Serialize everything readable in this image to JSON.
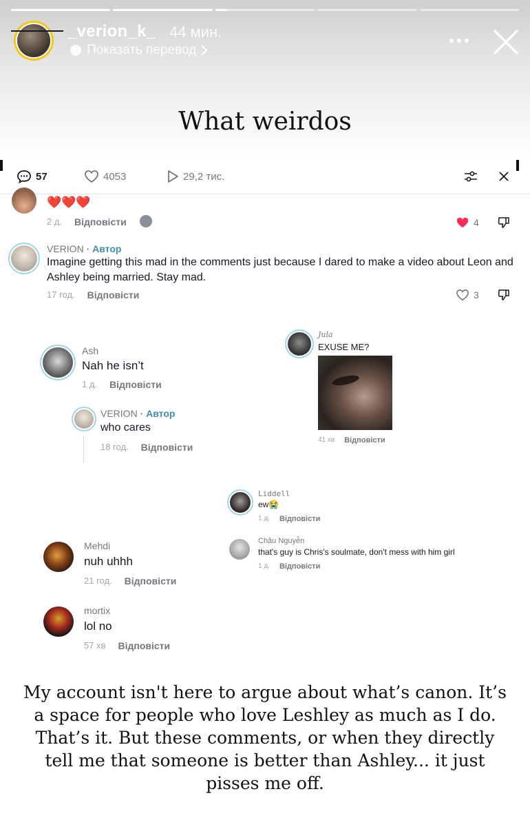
{
  "story": {
    "username": "_verion_k_",
    "time": "44 мин.",
    "translate_label": "Показать перевод",
    "progress": [
      1.0,
      1.0,
      0.12,
      0.0,
      0.0
    ],
    "caption_top": "What weirdos",
    "caption_bottom": "My account isn't here to argue about what’s canon. It’s a space for people who love Leshley as much as I do. That’s it. But these comments, or when they directly tell me that someone is better than Ashley... it just pisses me off."
  },
  "tabs": {
    "comments": "57",
    "likes": "4053",
    "views": "29,2 тис."
  },
  "comments": {
    "c0": {
      "text": "❤️❤️❤️",
      "time": "2 д.",
      "reply": "Відповісти",
      "likes": "4"
    },
    "c1": {
      "name": "VERION",
      "author": "· Автор",
      "text": "Imagine getting this mad in the comments just because I dared to make a video about Leon and Ashley being married. Stay mad.",
      "time": "17 год.",
      "reply": "Відповісти",
      "likes": "3"
    },
    "c2": {
      "name": "Ash",
      "text": "Nah he isn’t",
      "time": "1 д.",
      "reply": "Відповісти"
    },
    "c3": {
      "name": "VERION",
      "author": "· Автор",
      "text": "who cares",
      "time": "18 год.",
      "reply": "Відповісти"
    },
    "c4": {
      "name": "Jula",
      "text": "EXUSE ME?",
      "time": "41 хв",
      "reply": "Відповісти"
    },
    "c5": {
      "name": "Liddell",
      "text": "ew😭",
      "time": "1 д.",
      "reply": "Відповісти"
    },
    "c6": {
      "name": "Châu Nguyễn",
      "text": "that's guy is Chris's soulmate, don't mess with him girl",
      "time": "1 д.",
      "reply": "Відповісти"
    },
    "c7": {
      "name": "Mehdi",
      "text": "nuh uhhh",
      "time": "21 год.",
      "reply": "Відповісти"
    },
    "c8": {
      "name": "mortix",
      "text": "lol no",
      "time": "57 хв",
      "reply": "Відповісти"
    }
  },
  "colors": {
    "heart": "#fe2c55",
    "author": "#3f8fa6",
    "ring": "#9fd7e3"
  }
}
